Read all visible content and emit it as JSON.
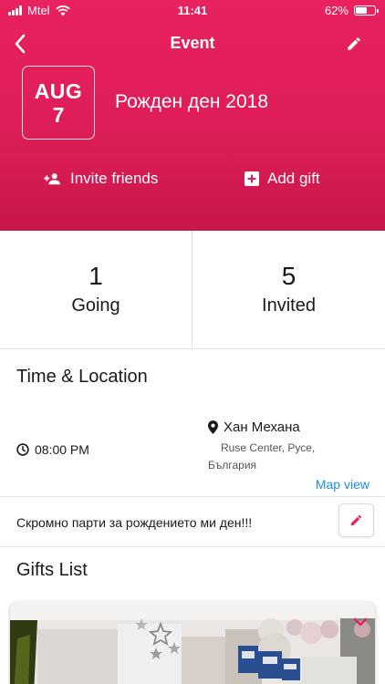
{
  "status_bar": {
    "carrier": "Mtel",
    "time": "11:41",
    "battery_percent": "62%",
    "battery_level": 0.62
  },
  "nav": {
    "title": "Event",
    "back_icon": "chevron-left-icon",
    "edit_icon": "pencil-icon"
  },
  "event": {
    "month": "AUG",
    "day": "7",
    "name": "Рожден ден 2018"
  },
  "actions": {
    "invite_label": "Invite friends",
    "add_gift_label": "Add gift"
  },
  "stats": {
    "going_count": "1",
    "going_label": "Going",
    "invited_count": "5",
    "invited_label": "Invited"
  },
  "time_location": {
    "title": "Time & Location",
    "time": "08:00 PM",
    "place_name": "Хан Механа",
    "address_line1": "Ruse Center, Русе,",
    "address_line2": "България",
    "map_view_label": "Map view"
  },
  "description": {
    "text": "Скромно парти за рождението ми ден!!!"
  },
  "gifts": {
    "title": "Gifts List"
  },
  "colors": {
    "accent": "#e8215f",
    "link": "#1c8ce5"
  }
}
